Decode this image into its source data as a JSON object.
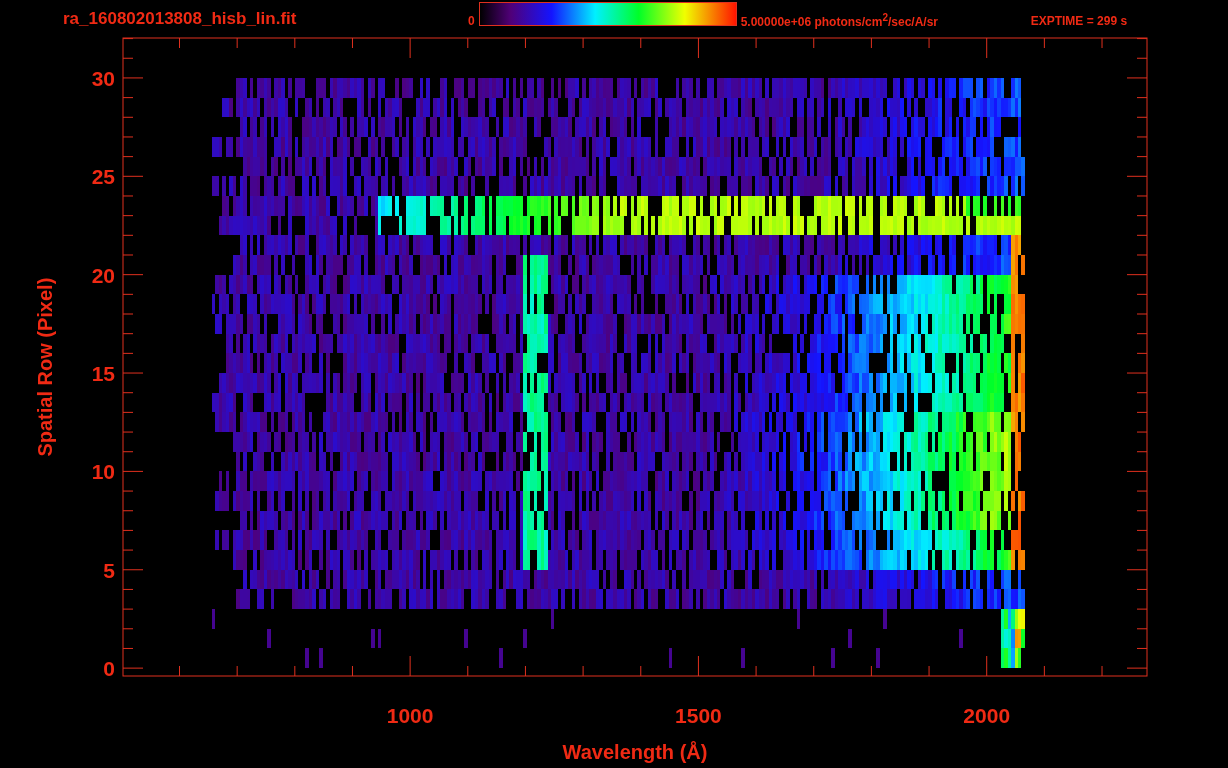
{
  "title": "ra_160802013808_hisb_lin.fit",
  "colorbar": {
    "min_label": "0",
    "max_label": "5.00000e+06 photons/cm$^{2}$/sec/A/sr"
  },
  "exposure": "EXPTIME = 299 s",
  "x_axis": {
    "title": "Wavelength (Å)",
    "tick_labels": [
      "1000",
      "1500",
      "2000"
    ]
  },
  "y_axis": {
    "title": "Spatial Row (Pixel)",
    "tick_labels": [
      "30",
      "25",
      "20",
      "15",
      "10",
      "5",
      "0"
    ]
  }
}
